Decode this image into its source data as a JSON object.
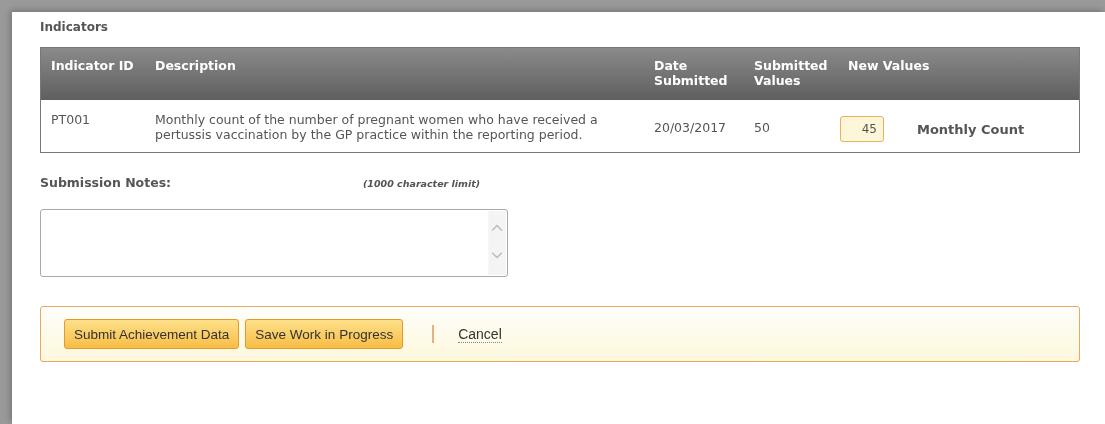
{
  "section_title": "Indicators",
  "table": {
    "columns": [
      "Indicator ID",
      "Description",
      "Date Submitted",
      "Submitted Values",
      "New Values"
    ],
    "rows": [
      {
        "id": "PT001",
        "description": "Monthly count of the number of pregnant women who have received a pertussis vaccination by the GP practice within the reporting period.",
        "date_submitted": "20/03/2017",
        "submitted_value": "50",
        "new_value": "45",
        "unit": "Monthly Count"
      }
    ]
  },
  "notes": {
    "label": "Submission Notes:",
    "limit": "(1000 character limit)"
  },
  "buttons": [
    "Submit Achievement Data",
    "Save Work in Progress"
  ],
  "cancel": "Cancel"
}
